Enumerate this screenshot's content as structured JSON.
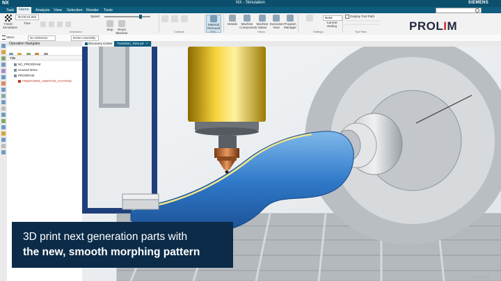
{
  "app": {
    "short_name": "NX",
    "window_title": "NX - Simulation",
    "vendor": "SIEMENS"
  },
  "menu_tabs": [
    "Task",
    "Home",
    "Analysis",
    "View",
    "Selection",
    "Render",
    "Tools"
  ],
  "ribbon": {
    "finish_label": "Finish Simulation",
    "time_label": "Time",
    "time_value": "00:00:03.855",
    "speed_label": "Speed",
    "stop_label": "Stop",
    "reset_label": "Reset Machine",
    "animation_group": "Animation",
    "collision_group": "Collision",
    "ipw_group": "IPW",
    "material_removal_label": "Material Removal",
    "details_label": "Details",
    "machine_components_label": "Machine Components",
    "machine_status_label": "Machine Status",
    "execution_view_label": "Execution View",
    "program_manager_label": "Program Manager",
    "views_group": "Views",
    "current_setting_label": "Current Setting",
    "settings_group": "Settings",
    "none_value": "None",
    "display_tool_path_label": "Display Tool Path",
    "tool_path_group": "Tool Path"
  },
  "logo": {
    "text_before": "PROL",
    "text_mark": "I",
    "text_after": "M"
  },
  "toolbar2": {
    "menu_label": "Menu",
    "filter_value": "No Selection Filter",
    "assembly_value": "Entire Assembly"
  },
  "navigator": {
    "title": "Operation Navigator",
    "column_title": "Title",
    "items": [
      {
        "label": "NC_PROGRAM",
        "indent": 1,
        "color": "#222222"
      },
      {
        "label": "Unused Items",
        "indent": 1,
        "color": "#222222"
      },
      {
        "label": "PROGRAM",
        "indent": 1,
        "color": "#222222"
      },
      {
        "label": "FREEFORM_ADDITIVE_COATING",
        "indent": 2,
        "color": "#c0392b"
      }
    ]
  },
  "view_tabs": [
    "Discovery Center",
    "Transition_Tube.prt"
  ],
  "caption": {
    "line1": "3D print next generation parts with",
    "line2": "the new, smooth morphing pattern"
  },
  "footer_brand": "SIEMENS"
}
